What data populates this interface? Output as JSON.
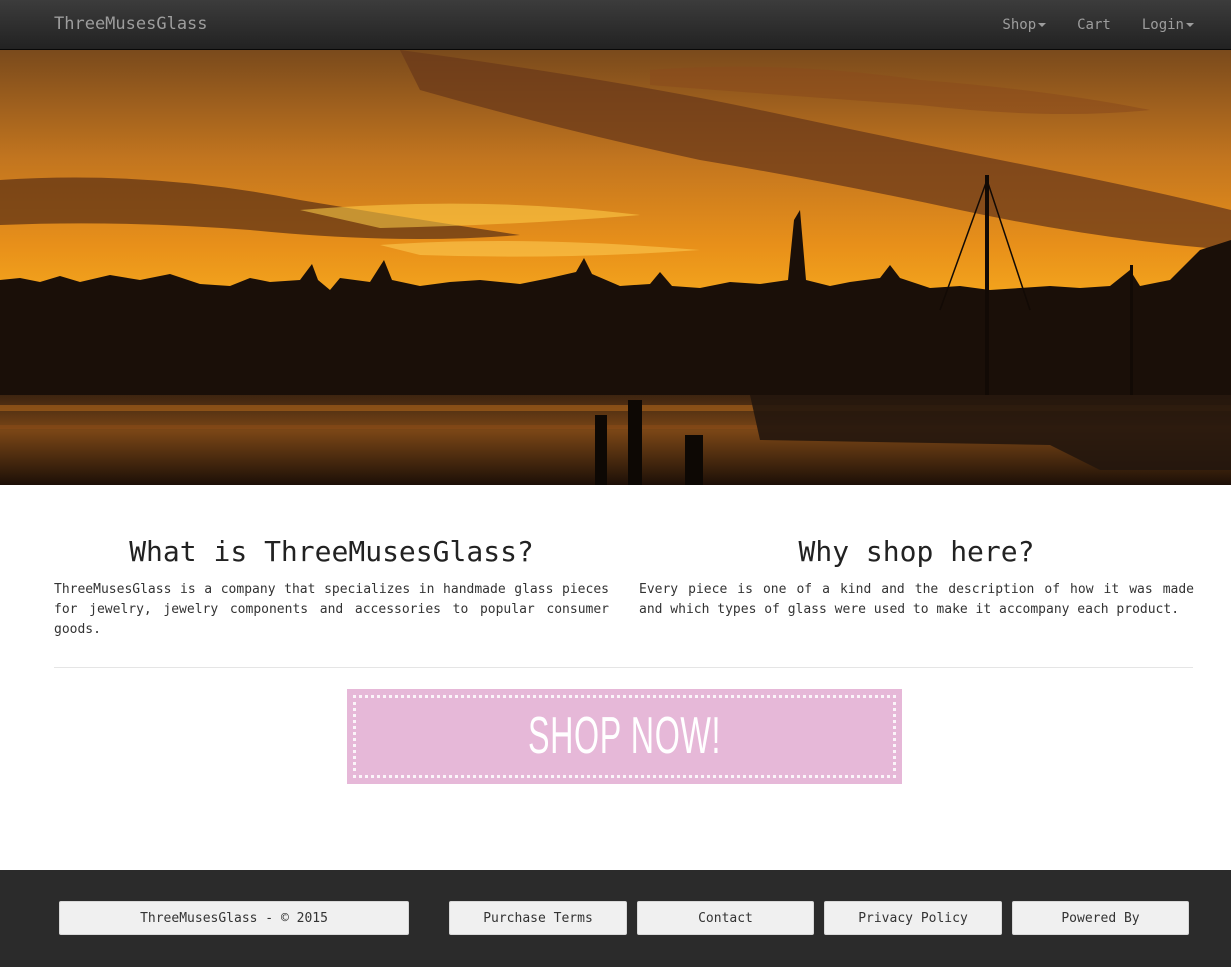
{
  "navbar": {
    "brand": "ThreeMusesGlass",
    "items": [
      {
        "label": "Shop",
        "dropdown": true
      },
      {
        "label": "Cart",
        "dropdown": false
      },
      {
        "label": "Login",
        "dropdown": true
      }
    ]
  },
  "hero": {
    "image": "sunset-harbor-skyline"
  },
  "info": {
    "left": {
      "title": "What is ThreeMusesGlass?",
      "body": "ThreeMusesGlass is a company that specializes in handmade glass pieces for jewelry, jewelry components and accessories to popular consumer goods."
    },
    "right": {
      "title": "Why shop here?",
      "body": "Every piece is one of a kind and the description of how it was made and which types of glass were used to make it accompany each product."
    }
  },
  "shop_banner": {
    "label": "SHOP NOW!",
    "color": "#e6b8d8"
  },
  "footer": {
    "copyright": "ThreeMusesGlass - © 2015",
    "links": [
      "Purchase Terms",
      "Contact",
      "Privacy Policy",
      "Powered By"
    ]
  }
}
